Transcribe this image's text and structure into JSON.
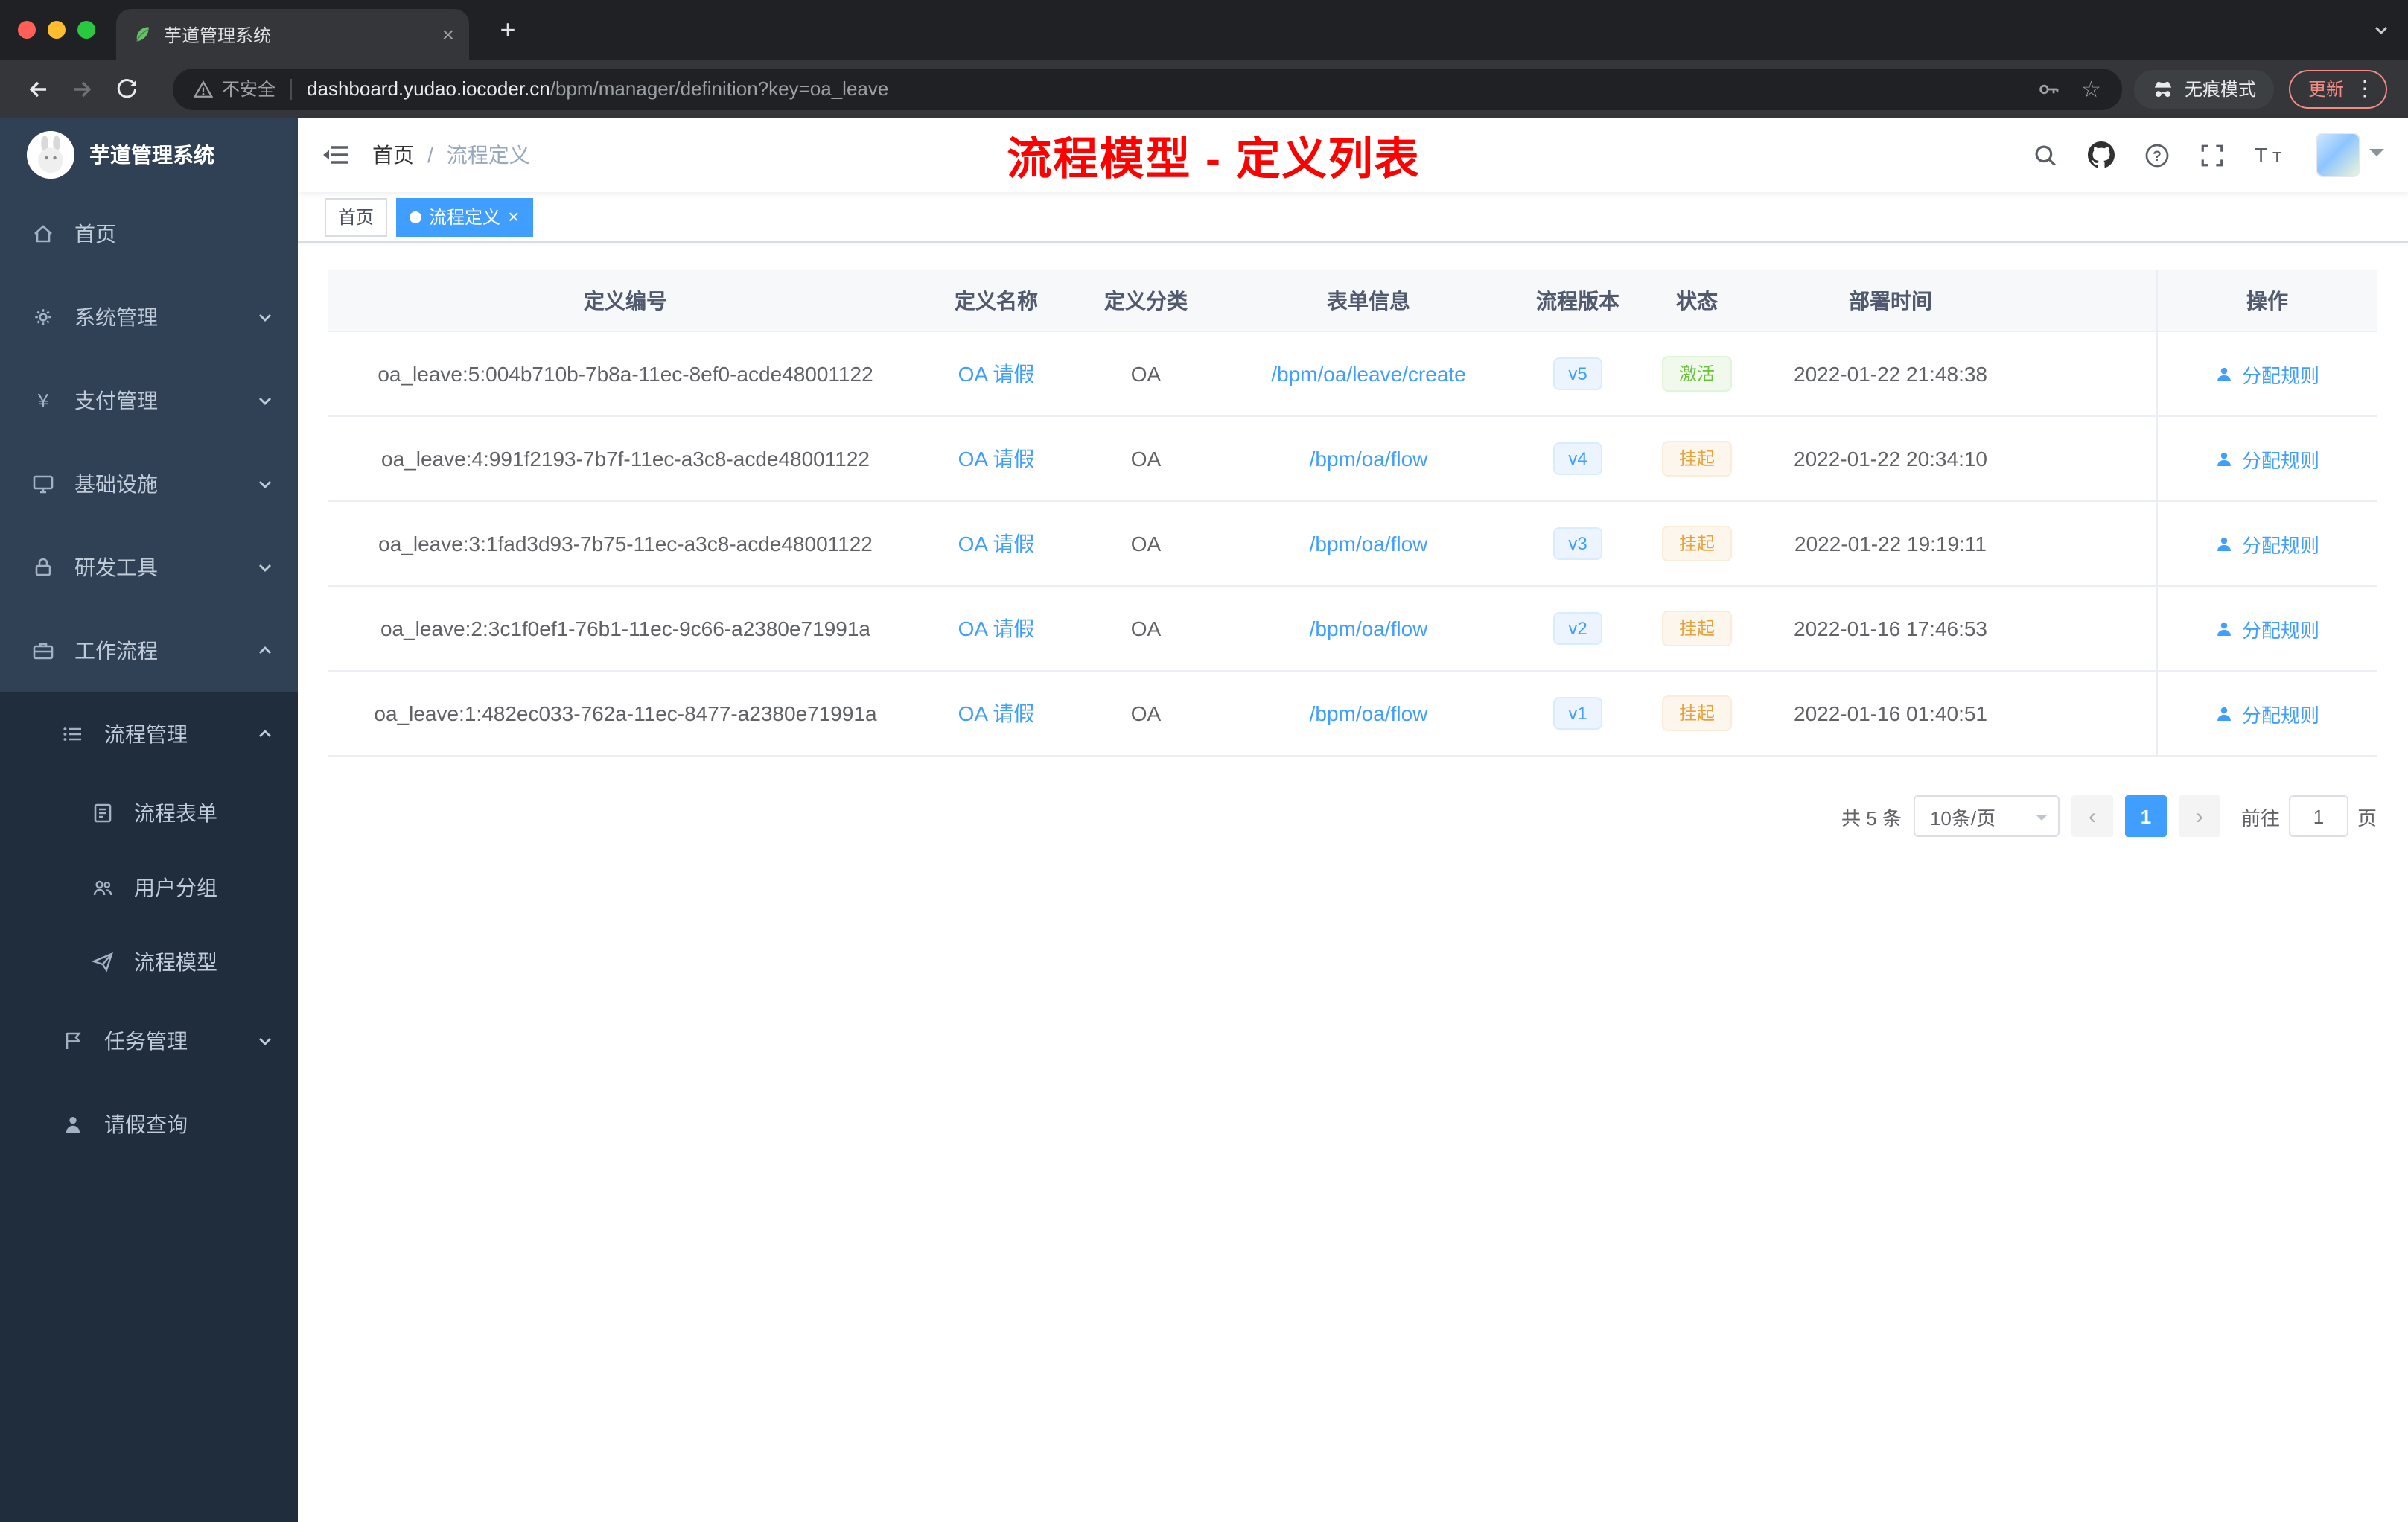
{
  "browser": {
    "tab_title": "芋道管理系统",
    "security_label": "不安全",
    "url_host": "dashboard.yudao.iocoder.cn",
    "url_path": "/bpm/manager/definition?key=oa_leave",
    "incognito_label": "无痕模式",
    "update_label": "更新"
  },
  "icons": {
    "new_tab": "+",
    "tab_close": "×",
    "browser_menu": "⋮",
    "bookmark_star": "☆",
    "tag_close": "×"
  },
  "sidebar": {
    "logo_title": "芋道管理系统",
    "items": [
      {
        "label": "首页"
      },
      {
        "label": "系统管理"
      },
      {
        "label": "支付管理"
      },
      {
        "label": "基础设施"
      },
      {
        "label": "研发工具"
      },
      {
        "label": "工作流程"
      },
      {
        "label": "流程管理"
      },
      {
        "label": "流程表单"
      },
      {
        "label": "用户分组"
      },
      {
        "label": "流程模型"
      },
      {
        "label": "任务管理"
      },
      {
        "label": "请假查询"
      }
    ]
  },
  "navbar": {
    "breadcrumb_home": "首页",
    "breadcrumb_separator": "/",
    "breadcrumb_current": "流程定义",
    "annotation": "流程模型 - 定义列表"
  },
  "tags": {
    "home": "首页",
    "active": "流程定义"
  },
  "table": {
    "columns": [
      "定义编号",
      "定义名称",
      "定义分类",
      "表单信息",
      "流程版本",
      "状态",
      "部署时间",
      "操作"
    ],
    "rows": [
      {
        "id": "oa_leave:5:004b710b-7b8a-11ec-8ef0-acde48001122",
        "name": "OA 请假",
        "category": "OA",
        "form": "/bpm/oa/leave/create",
        "version": "v5",
        "status": "激活",
        "time": "2022-01-22 21:48:38",
        "action": "分配规则"
      },
      {
        "id": "oa_leave:4:991f2193-7b7f-11ec-a3c8-acde48001122",
        "name": "OA 请假",
        "category": "OA",
        "form": "/bpm/oa/flow",
        "version": "v4",
        "status": "挂起",
        "time": "2022-01-22 20:34:10",
        "action": "分配规则"
      },
      {
        "id": "oa_leave:3:1fad3d93-7b75-11ec-a3c8-acde48001122",
        "name": "OA 请假",
        "category": "OA",
        "form": "/bpm/oa/flow",
        "version": "v3",
        "status": "挂起",
        "time": "2022-01-22 19:19:11",
        "action": "分配规则"
      },
      {
        "id": "oa_leave:2:3c1f0ef1-76b1-11ec-9c66-a2380e71991a",
        "name": "OA 请假",
        "category": "OA",
        "form": "/bpm/oa/flow",
        "version": "v2",
        "status": "挂起",
        "time": "2022-01-16 17:46:53",
        "action": "分配规则"
      },
      {
        "id": "oa_leave:1:482ec033-762a-11ec-8477-a2380e71991a",
        "name": "OA 请假",
        "category": "OA",
        "form": "/bpm/oa/flow",
        "version": "v1",
        "status": "挂起",
        "time": "2022-01-16 01:40:51",
        "action": "分配规则"
      }
    ]
  },
  "pagination": {
    "total": "共 5 条",
    "page_size": "10条/页",
    "prev": "‹",
    "current": "1",
    "next": "›",
    "goto": "前往",
    "goto_value": "1",
    "unit": "页"
  },
  "colors": {
    "accent": "#409eff",
    "success": "#67c23a",
    "warning": "#e6a23c",
    "annotation": "#ff0000",
    "sidebar_bg": "#304156",
    "submenu_bg": "#1f2d3d"
  }
}
